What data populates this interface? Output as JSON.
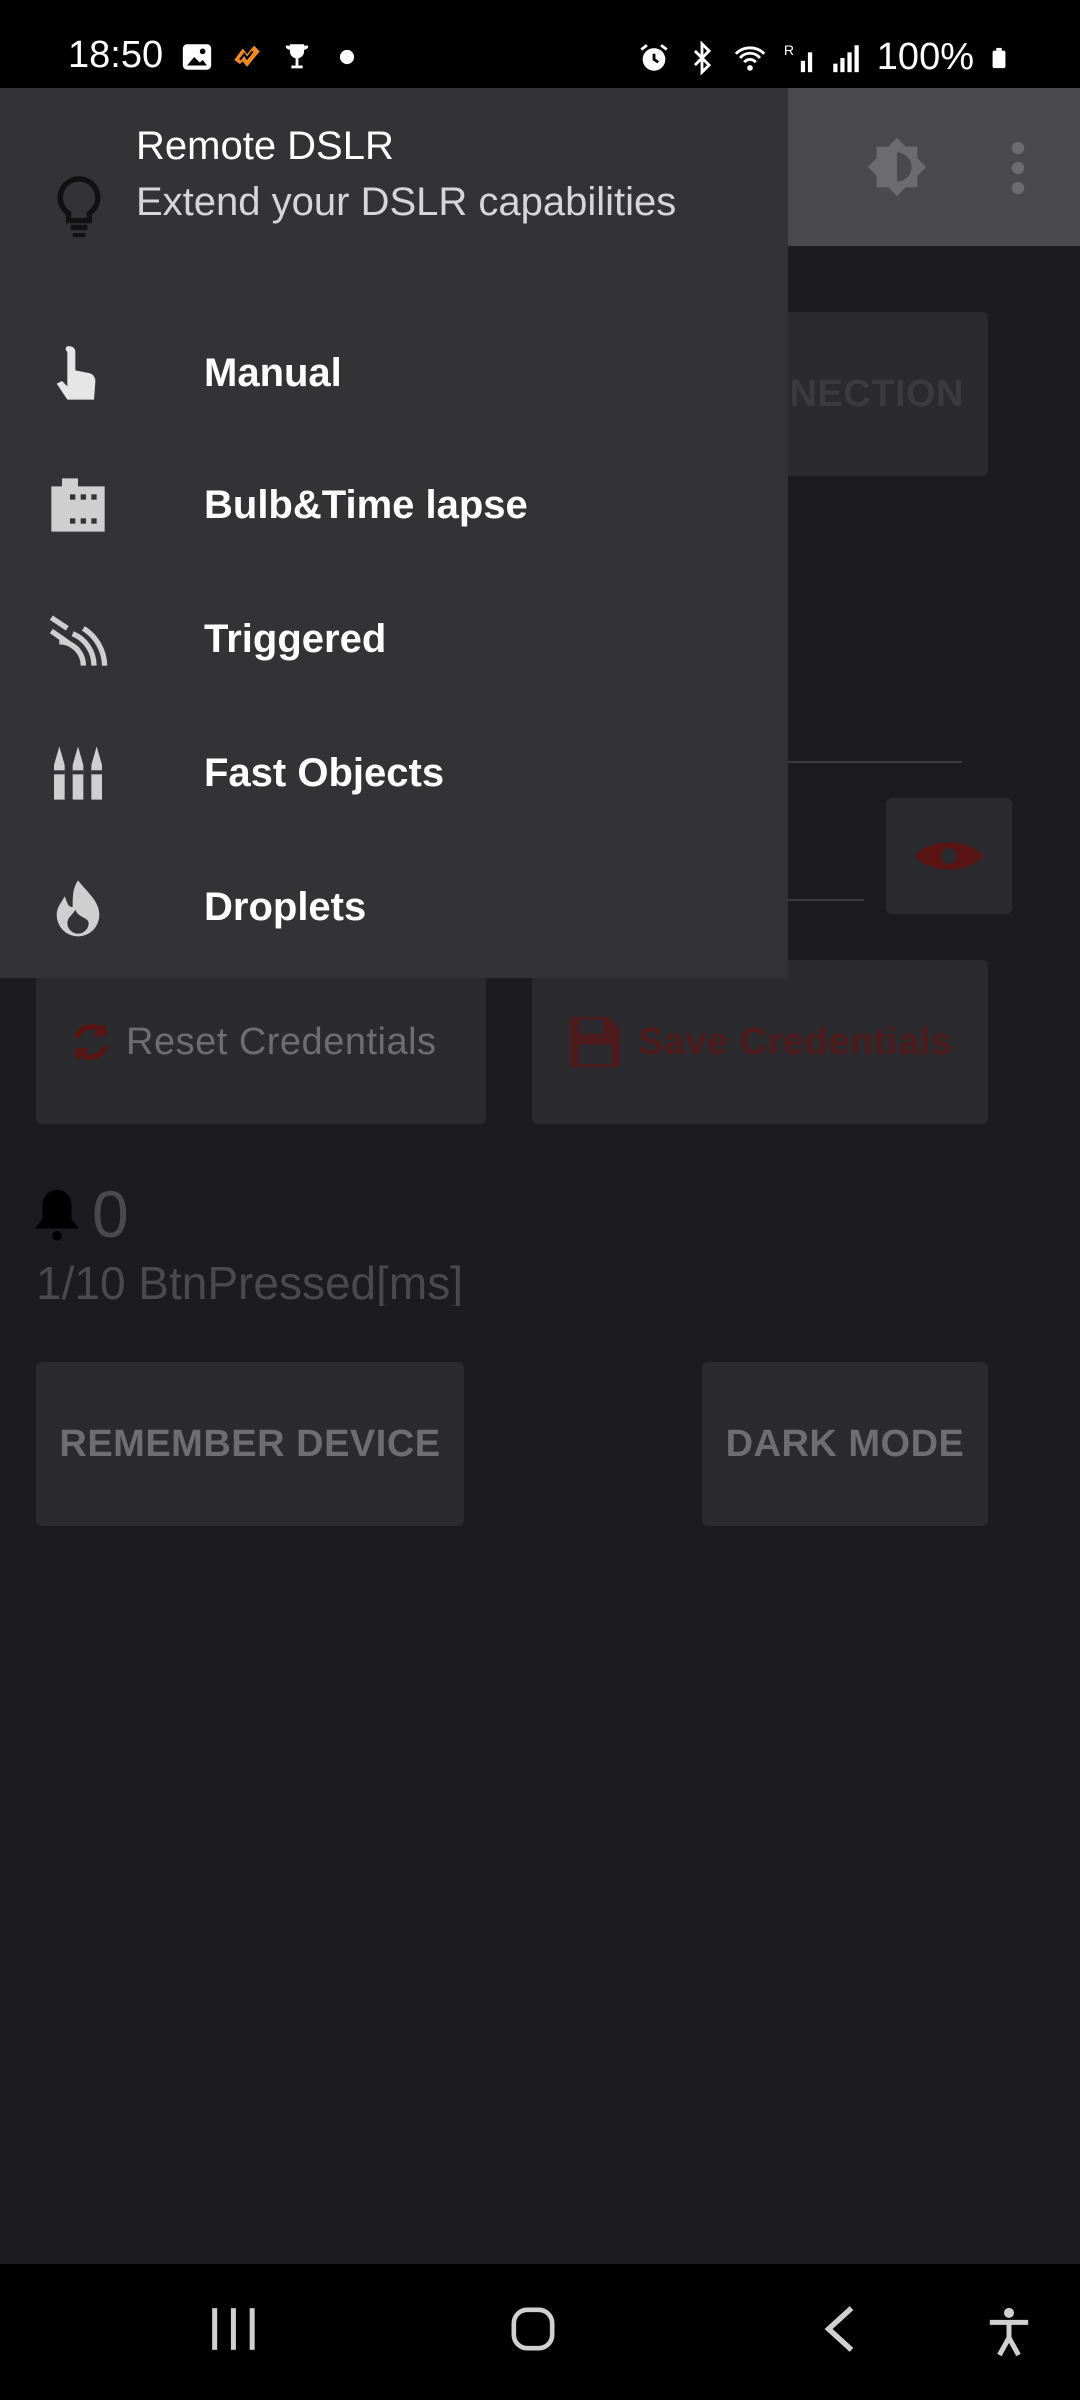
{
  "status_bar": {
    "time": "18:50",
    "battery": "100%",
    "icons_left": [
      "gallery-icon",
      "strava-icon",
      "trophy-icon",
      "dot-icon"
    ],
    "icons_right": [
      "alarm-icon",
      "bluetooth-icon",
      "wifi-call-icon",
      "signal-r-icon",
      "signal-icon",
      "battery-icon"
    ]
  },
  "drawer": {
    "title": "Remote DSLR",
    "subtitle": "Extend your DSLR capabilities",
    "header_icon": "lightbulb-icon",
    "items": [
      {
        "label": "Manual",
        "icon": "touch-icon"
      },
      {
        "label": "Bulb&Time lapse",
        "icon": "film-icon"
      },
      {
        "label": "Triggered",
        "icon": "signal-waves-icon"
      },
      {
        "label": "Fast Objects",
        "icon": "bullets-icon"
      },
      {
        "label": "Droplets",
        "icon": "flame-icon"
      }
    ]
  },
  "background_app": {
    "connection_button": "NECTION",
    "reset_button": "Reset Credentials",
    "save_button": "Save Credentials",
    "counter_value": "0",
    "btn_pressed_text": "1/10 BtnPressed[ms]",
    "remember_button": "REMEMBER DEVICE",
    "dark_mode_button": "DARK MODE"
  },
  "colors": {
    "drawer_bg": "#333235",
    "app_bg": "#1c1b1f",
    "appbar_bg": "#4a494d",
    "accent_red": "#c01818"
  }
}
